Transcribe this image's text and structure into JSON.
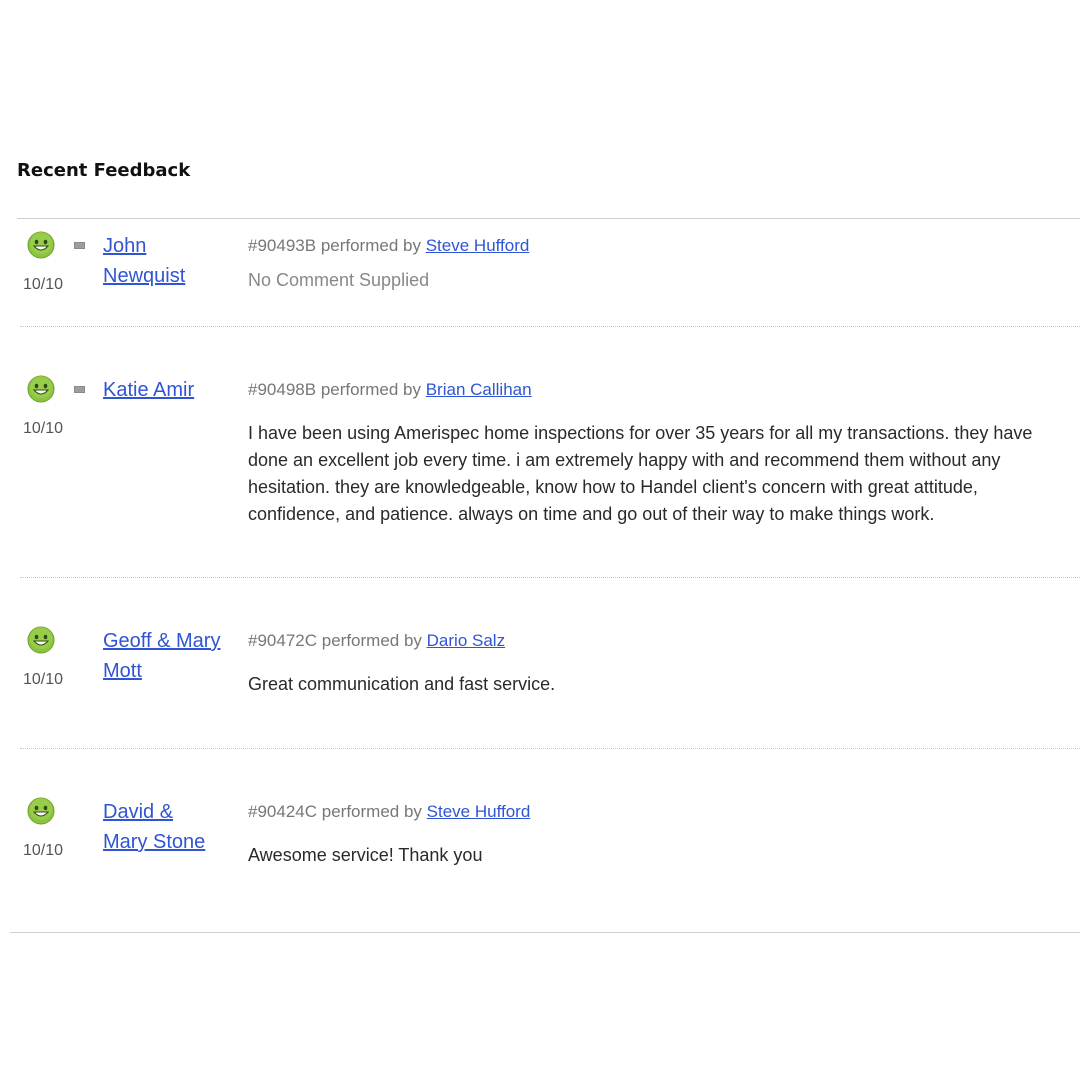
{
  "section": {
    "title": "Recent Feedback"
  },
  "performed_by_text": "performed by",
  "colors": {
    "link": "#2f55d4",
    "face": "#8bc53f"
  },
  "entries": [
    {
      "score": "10/10",
      "has_flag": true,
      "client": "John Newquist",
      "order": "#90493B",
      "inspector": "Steve Hufford",
      "comment": "No Comment Supplied"
    },
    {
      "score": "10/10",
      "has_flag": true,
      "client": "Katie Amir",
      "order": "#90498B",
      "inspector": "Brian Callihan",
      "comment": "I have been using Amerispec home inspections for over 35 years for all my transactions. they have done an excellent job every time. i am extremely happy with and recommend them without any hesitation. they are knowledgeable, know how to Handel client's concern with great attitude, confidence, and patience. always on time and go out of their way to make things work."
    },
    {
      "score": "10/10",
      "has_flag": false,
      "client": "Geoff & Mary Mott",
      "order": "#90472C",
      "inspector": "Dario Salz",
      "comment": "Great communication and fast service."
    },
    {
      "score": "10/10",
      "has_flag": false,
      "client": "David & Mary Stone",
      "order": "#90424C",
      "inspector": "Steve Hufford",
      "comment": "Awesome service! Thank you"
    }
  ]
}
